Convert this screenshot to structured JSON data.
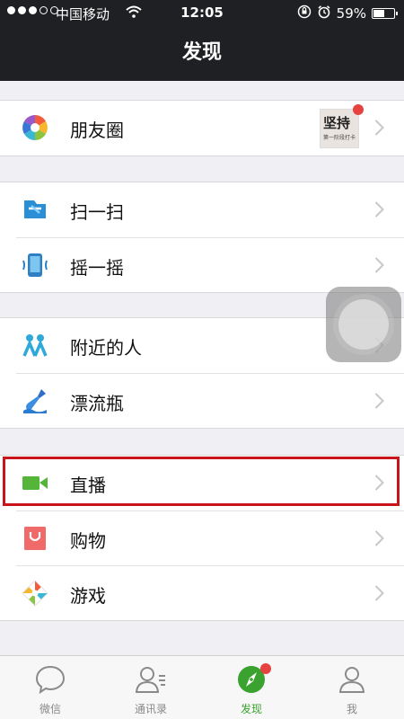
{
  "status_bar": {
    "carrier": "中国移动",
    "time": "12:05",
    "battery": "59%",
    "battery_level": 0.59,
    "signal_bars_filled": 3,
    "signal_bars_total": 5
  },
  "nav": {
    "title": "发现"
  },
  "groups": [
    {
      "items": [
        {
          "label": "朋友圈",
          "icon": "moments-aperture-icon",
          "thumbnail_text": "坚持",
          "thumbnail_subtext": "第一阶段打卡"
        }
      ]
    },
    {
      "items": [
        {
          "label": "扫一扫",
          "icon": "scan-icon"
        },
        {
          "label": "摇一摇",
          "icon": "shake-icon"
        }
      ]
    },
    {
      "items": [
        {
          "label": "附近的人",
          "icon": "people-nearby-icon"
        },
        {
          "label": "漂流瓶",
          "icon": "drift-bottle-icon"
        }
      ]
    },
    {
      "items": [
        {
          "label": "直播",
          "icon": "live-camera-icon"
        },
        {
          "label": "购物",
          "icon": "shopping-icon"
        },
        {
          "label": "游戏",
          "icon": "games-icon"
        }
      ]
    }
  ],
  "tabbar": {
    "items": [
      {
        "label": "微信",
        "icon": "chat-bubble-icon"
      },
      {
        "label": "通讯录",
        "icon": "contacts-icon"
      },
      {
        "label": "发现",
        "icon": "compass-icon",
        "active": true
      },
      {
        "label": "我",
        "icon": "profile-icon"
      }
    ]
  },
  "colors": {
    "nav_bg": "#1f2023",
    "accent_green": "#3aa22e",
    "highlight_red": "#c8141a",
    "badge_red": "#e64340"
  }
}
